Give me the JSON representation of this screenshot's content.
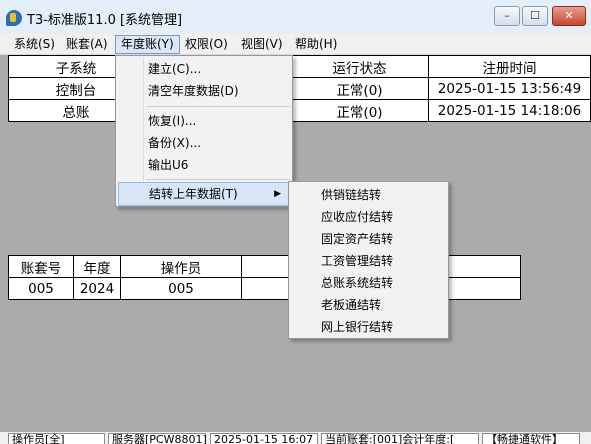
{
  "window": {
    "title": "T3-标准版11.0 [系统管理]",
    "min": "–",
    "max": "☐",
    "close": "✕"
  },
  "menubar": [
    {
      "label": "系统(S)"
    },
    {
      "label": "账套(A)"
    },
    {
      "label": "年度账(Y)"
    },
    {
      "label": "权限(O)"
    },
    {
      "label": "视图(V)"
    },
    {
      "label": "帮助(H)"
    }
  ],
  "subsystems": {
    "headers": [
      "子系统",
      "运行状态",
      "注册时间"
    ],
    "rows": [
      [
        "控制台",
        "正常(0)",
        "2025-01-15 13:56:49"
      ],
      [
        "总账",
        "正常(0)",
        "2025-01-15 14:18:06"
      ]
    ]
  },
  "accounts": {
    "headers": [
      "账套号",
      "年度",
      "操作员"
    ],
    "rows": [
      [
        "005",
        "2024",
        "005"
      ]
    ]
  },
  "year_menu": {
    "items": [
      "建立(C)...",
      "清空年度数据(D)",
      "恢复(I)...",
      "备份(X)...",
      "输出U6",
      "结转上年数据(T)"
    ]
  },
  "carry_menu": {
    "items": [
      "供销链结转",
      "应收应付结转",
      "固定资产结转",
      "工资管理结转",
      "总账系统结转",
      "老板通结转",
      "网上银行结转"
    ]
  },
  "statusbar": {
    "operator": "操作员[全]",
    "server": "服务器[PCW8801]",
    "datetime": "2025-01-15 16:07",
    "current": "当前账套:[001]会计年度:[",
    "brand": "【畅捷通软件】"
  }
}
